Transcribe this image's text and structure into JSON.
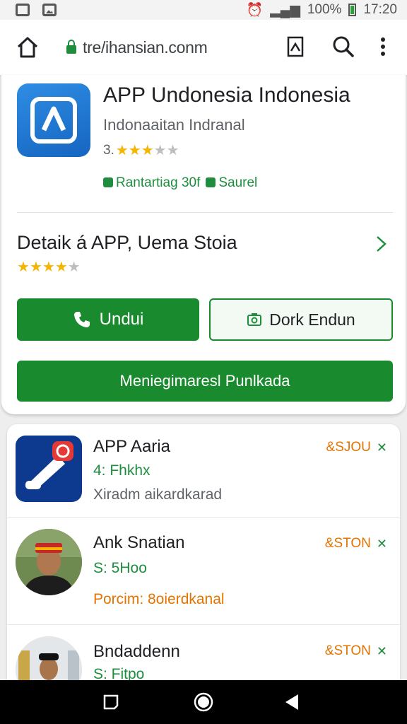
{
  "status_bar": {
    "time": "17:20",
    "battery": "100%"
  },
  "browser": {
    "url": "tre/ihansian.conm"
  },
  "app": {
    "title": "APP Undonesia Indonesia",
    "subtitle": "Indonaaitan Indranal",
    "rating_value": "3.",
    "rating_stars": 3,
    "badge1": "Rantartiag 30f",
    "badge2": "Saurel"
  },
  "detail": {
    "title": "Detaik á APP, Uema Stoia",
    "rating_stars": 4
  },
  "buttons": {
    "download": "Undui",
    "secondary": "Dork Endun",
    "wide": "Meniegimaresl Punlkada"
  },
  "list": [
    {
      "title": "APP Aaria",
      "subtitle": "4: Fhkhx",
      "description": "Xiradm aikardkarad",
      "price": "&SJOU"
    },
    {
      "title": "Ank Snatian",
      "subtitle": "S: 5Hoo",
      "description": "Porcim: 8oierdkanal",
      "price": "&STON"
    },
    {
      "title": "Bndaddenn",
      "subtitle": "S: Fitpo",
      "description": "",
      "price": "&STON"
    }
  ],
  "colors": {
    "accent": "#1a8a2e",
    "price": "#e37400",
    "star": "#f4b400"
  }
}
